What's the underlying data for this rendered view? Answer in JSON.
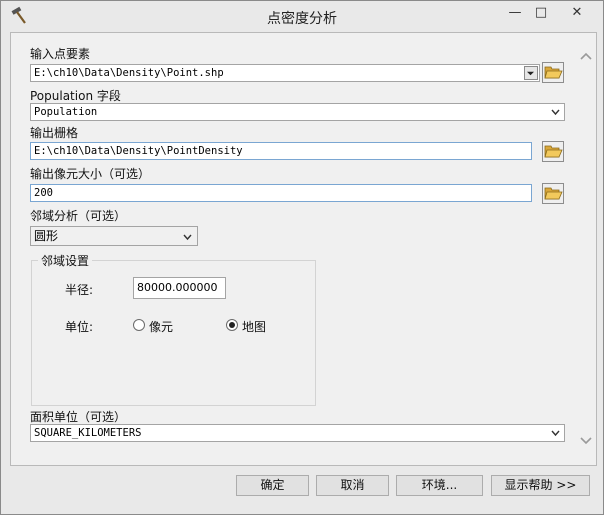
{
  "window": {
    "title": "点密度分析",
    "minimize_glyph": "—",
    "maximize_glyph": "□",
    "close_glyph": "✕",
    "app_icon": "hammer-icon"
  },
  "form": {
    "input_points": {
      "label": "输入点要素",
      "value": "E:\\ch10\\Data\\Density\\Point.shp"
    },
    "population_field": {
      "label": "Population 字段",
      "value": "Population"
    },
    "output_raster": {
      "label": "输出栅格",
      "value": "E:\\ch10\\Data\\Density\\PointDensity"
    },
    "cell_size": {
      "label": "输出像元大小（可选）",
      "value": "200"
    },
    "neighborhood": {
      "label": "邻域分析（可选）",
      "value": "圆形"
    },
    "neighborhood_settings": {
      "title": "邻域设置",
      "radius_label": "半径:",
      "radius_value": "80000.000000",
      "units_label": "单位:",
      "unit_options": [
        {
          "label": "像元",
          "selected": false
        },
        {
          "label": "地图",
          "selected": true
        }
      ]
    },
    "area_units": {
      "label": "面积单位（可选）",
      "value": "SQUARE_KILOMETERS"
    }
  },
  "buttons": {
    "ok": "确定",
    "cancel": "取消",
    "environments": "环境...",
    "show_help": "显示帮助 >>"
  },
  "icons": {
    "browse": "folder-open-icon",
    "dropdown": "chevron-down-icon",
    "scroll_up": "chevron-up-icon",
    "scroll_down": "chevron-down-icon"
  }
}
